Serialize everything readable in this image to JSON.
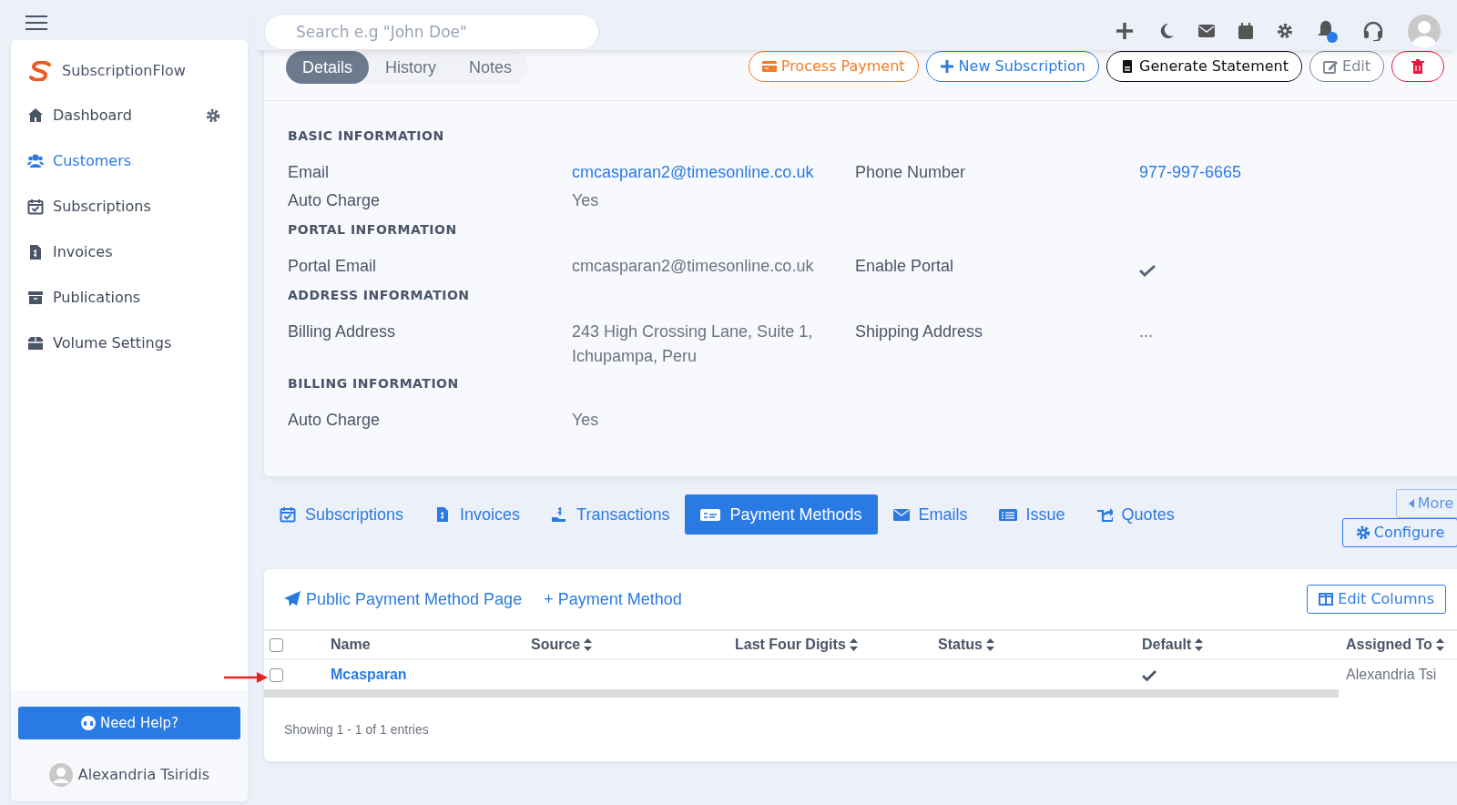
{
  "sidebar": {
    "brand": "SubscriptionFlow",
    "items": [
      {
        "label": "Dashboard",
        "selected": false,
        "settings": true
      },
      {
        "label": "Customers",
        "selected": true,
        "settings": false
      },
      {
        "label": "Subscriptions",
        "selected": false,
        "settings": false
      },
      {
        "label": "Invoices",
        "selected": false,
        "settings": false
      },
      {
        "label": "Publications",
        "selected": false,
        "settings": false
      },
      {
        "label": "Volume Settings",
        "selected": false,
        "settings": false
      }
    ],
    "help_button": "Need Help?",
    "user": "Alexandria Tsiridis"
  },
  "header": {
    "search": {
      "placeholder": "Search e.g \"John Doe\""
    }
  },
  "detail_tabs": [
    {
      "label": "Details",
      "selected": true
    },
    {
      "label": "History",
      "selected": false
    },
    {
      "label": "Notes",
      "selected": false
    }
  ],
  "actions": [
    {
      "kind": "process",
      "label": "Process Payment"
    },
    {
      "kind": "new",
      "label": "New Subscription"
    },
    {
      "kind": "statement",
      "label": "Generate Statement"
    },
    {
      "kind": "edit",
      "label": "Edit"
    },
    {
      "kind": "delete"
    }
  ],
  "sections": [
    {
      "title": "BASIC INFORMATION",
      "rows": [
        [
          {
            "label": "Email",
            "value": "cmcasparan2@timesonline.co.uk",
            "link": true
          },
          {
            "label": "Phone Number",
            "value": "977-997-6665",
            "link": true
          }
        ],
        [
          {
            "label": "Auto Charge",
            "value": "Yes",
            "link": false
          }
        ]
      ]
    },
    {
      "title": "PORTAL INFORMATION",
      "rows": [
        [
          {
            "label": "Portal Email",
            "value": "cmcasparan2@timesonline.co.uk",
            "link": false
          },
          {
            "label": "Enable Portal",
            "kind": "check",
            "checked": true
          }
        ]
      ]
    },
    {
      "title": "ADDRESS INFORMATION",
      "rows": [
        [
          {
            "label": "Billing Address",
            "value": "243 High Crossing Lane, Suite 1, Ichupampa, Peru",
            "link": false
          },
          {
            "label": "Shipping Address",
            "value": "...",
            "link": false
          }
        ]
      ]
    },
    {
      "title": "BILLING INFORMATION",
      "rows": [
        [
          {
            "label": "Auto Charge",
            "value": "Yes",
            "link": false
          }
        ]
      ]
    }
  ],
  "record_tabs": [
    {
      "label": "Subscriptions",
      "selected": false
    },
    {
      "label": "Invoices",
      "selected": false
    },
    {
      "label": "Transactions",
      "selected": false
    },
    {
      "label": "Payment Methods",
      "selected": true
    },
    {
      "label": "Emails",
      "selected": false
    },
    {
      "label": "Issue",
      "selected": false
    },
    {
      "label": "Quotes",
      "selected": false
    }
  ],
  "more_button": "More",
  "configure_button": "Configure",
  "payment_methods": {
    "links": [
      "Public Payment Method Page",
      "+ Payment Method"
    ],
    "edit_columns": "Edit Columns",
    "table": {
      "select_all": false,
      "columns": [
        {
          "label": "Name",
          "sortable": false
        },
        {
          "label": "Source",
          "sortable": true
        },
        {
          "label": "Last Four Digits",
          "sortable": true
        },
        {
          "label": "Status",
          "sortable": true
        },
        {
          "label": "Default",
          "sortable": true
        },
        {
          "label": "Assigned To",
          "sortable": true
        }
      ],
      "rows": [
        {
          "checked": false,
          "name": "Mcasparan",
          "default": true,
          "assigned_to": "Alexandria Tsi"
        }
      ]
    },
    "footer": "Showing 1 - 1 of 1 entries"
  }
}
